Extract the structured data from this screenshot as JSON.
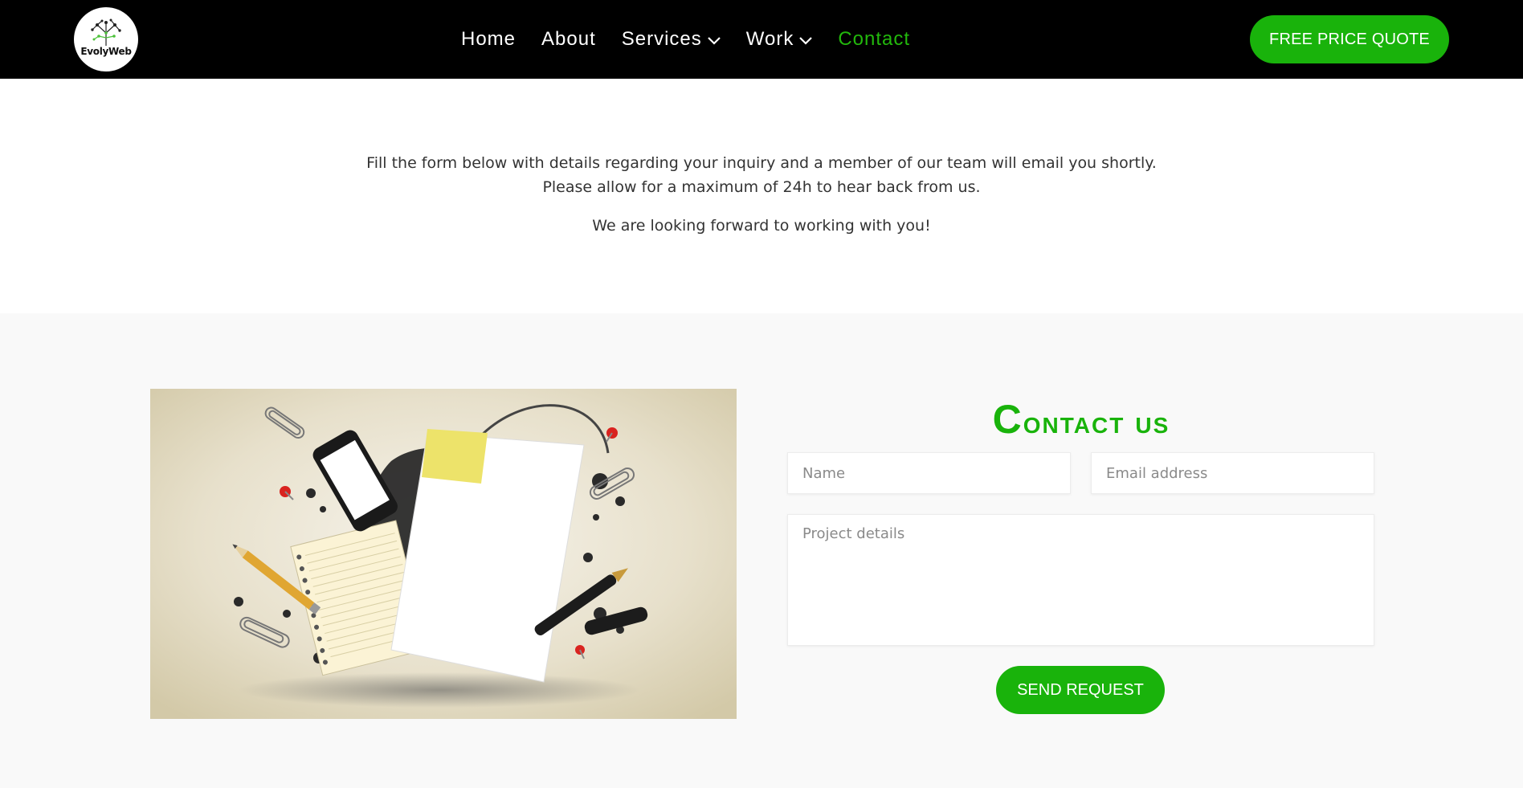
{
  "header": {
    "logo_text": "EvolyWeb",
    "nav": [
      {
        "label": "Home"
      },
      {
        "label": "About"
      },
      {
        "label": "Services"
      },
      {
        "label": "Work"
      },
      {
        "label": "Contact"
      }
    ],
    "quote_button": "FREE PRICE QUOTE"
  },
  "intro": {
    "line1": "Fill the form below with details regarding your inquiry and a member of our team will email you shortly.",
    "line2": "Please allow for a maximum of 24h to hear back from us.",
    "line3": "We are looking forward to working with you!"
  },
  "form": {
    "title_first": "C",
    "title_rest": "ontact us",
    "name_placeholder": "Name",
    "email_placeholder": "Email address",
    "details_placeholder": "Project details",
    "submit_label": "SEND REQUEST"
  },
  "colors": {
    "accent": "#19b30b",
    "header_bg": "#000000",
    "section_bg": "#f9f9f9"
  },
  "icons": {
    "services_dropdown": "chevron-down-icon",
    "work_dropdown": "chevron-down-icon"
  }
}
